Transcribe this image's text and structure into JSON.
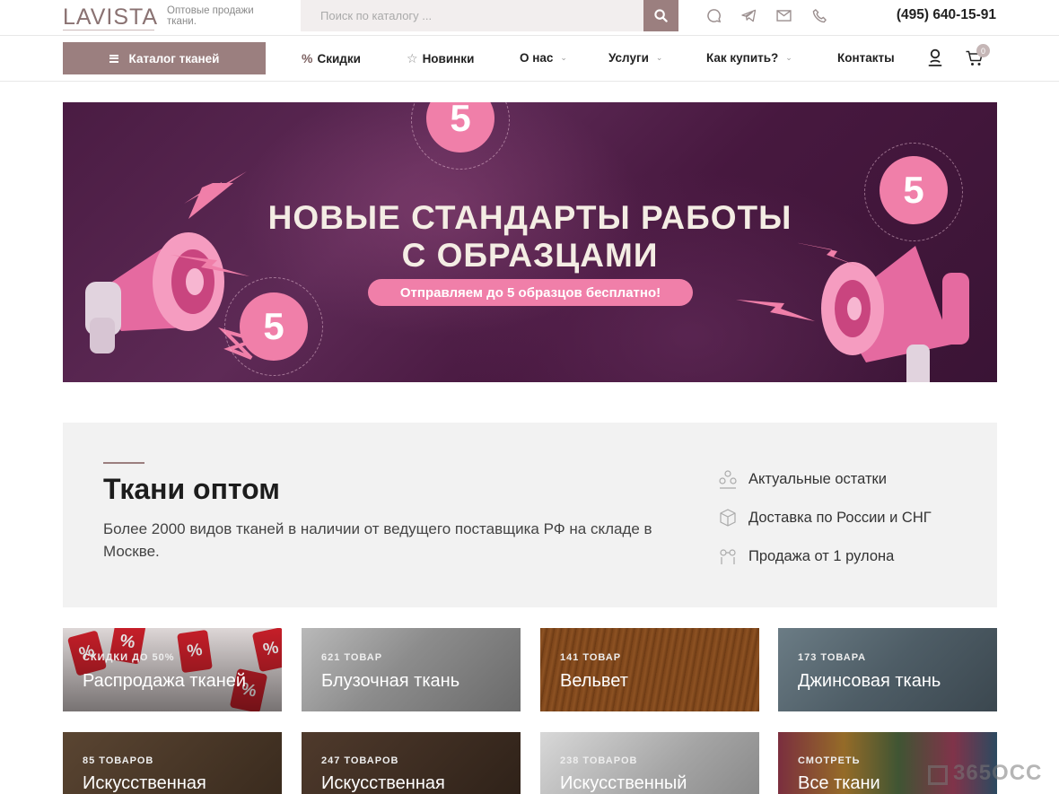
{
  "header": {
    "logo": "LAVISTA",
    "tagline": "Оптовые продажи ткани.",
    "search_placeholder": "Поиск по каталогу ...",
    "phone": "(495) 640-15-91",
    "social_icons": [
      "chat-icon",
      "telegram-icon",
      "mail-icon",
      "phone-call-icon"
    ]
  },
  "nav": {
    "catalog_label": "Каталог тканей",
    "items": [
      {
        "label": "Скидки",
        "icon": "percent-icon"
      },
      {
        "label": "Новинки",
        "icon": "star-icon"
      },
      {
        "label": "О нас",
        "dropdown": true
      },
      {
        "label": "Услуги",
        "dropdown": true
      },
      {
        "label": "Как купить?",
        "dropdown": true
      },
      {
        "label": "Контакты"
      }
    ],
    "cart_count": "0"
  },
  "banner": {
    "title_line1": "НОВЫЕ СТАНДАРТЫ РАБОТЫ",
    "title_line2": "С ОБРАЗЦАМИ",
    "pill": "Отправляем до 5 образцов бесплатно!",
    "badge": "5",
    "ring_text": "отправляем до 5 образцов бесплатно"
  },
  "info": {
    "title": "Ткани оптом",
    "text": "Более 2000 видов тканей в наличии от ведущего поставщика РФ на складе в Москве.",
    "features": [
      {
        "label": "Актуальные остатки",
        "icon": "stock-icon"
      },
      {
        "label": "Доставка по России и СНГ",
        "icon": "box-icon"
      },
      {
        "label": "Продажа от 1 рулона",
        "icon": "roll-icon"
      }
    ]
  },
  "categories": [
    {
      "count": "СКИДКИ ДО 50%",
      "name": "Распродажа тканей"
    },
    {
      "count": "621 ТОВАР",
      "name": "Блузочная ткань"
    },
    {
      "count": "141 ТОВАР",
      "name": "Вельвет"
    },
    {
      "count": "173 ТОВАРА",
      "name": "Джинсовая ткань"
    },
    {
      "count": "85 ТОВАРОВ",
      "name": "Искусственная"
    },
    {
      "count": "247 ТОВАРОВ",
      "name": "Искусственная"
    },
    {
      "count": "238 ТОВАРОВ",
      "name": "Искусственный"
    },
    {
      "count": "СМОТРЕТЬ",
      "name": "Все ткани"
    }
  ],
  "watermark": "365OCC",
  "colors": {
    "accent": "#9b7f7f",
    "pink": "#f07fa9",
    "banner_bg": "#4a1c43"
  }
}
